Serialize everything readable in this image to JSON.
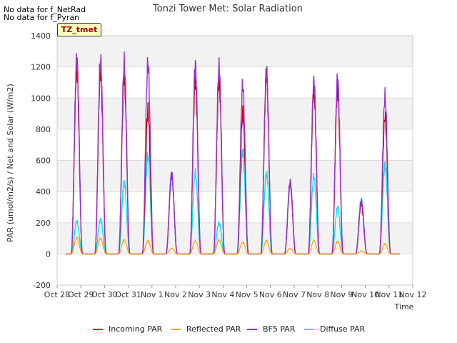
{
  "notes": [
    "No data for f_NetRad",
    "No data for f_Pyran"
  ],
  "badge": "TZ_tmet",
  "chart_data": {
    "type": "line",
    "title": "Tonzi Tower Met: Solar Radiation",
    "xlabel": "Time",
    "ylabel": "PAR (umol/m2/s) / Net and Solar (W/m2)",
    "ylim": [
      -200,
      1400
    ],
    "yticks": [
      -200,
      0,
      200,
      400,
      600,
      800,
      1000,
      1200,
      1400
    ],
    "xlim": [
      0,
      15
    ],
    "xticks": [
      {
        "pos": 0,
        "label": "Oct 28"
      },
      {
        "pos": 1,
        "label": "Oct 29"
      },
      {
        "pos": 2,
        "label": "Oct 30"
      },
      {
        "pos": 3,
        "label": "Oct 31"
      },
      {
        "pos": 4,
        "label": "Nov 1"
      },
      {
        "pos": 5,
        "label": "Nov 2"
      },
      {
        "pos": 6,
        "label": "Nov 3"
      },
      {
        "pos": 7,
        "label": "Nov 4"
      },
      {
        "pos": 8,
        "label": "Nov 5"
      },
      {
        "pos": 9,
        "label": "Nov 6"
      },
      {
        "pos": 10,
        "label": "Nov 7"
      },
      {
        "pos": 11,
        "label": "Nov 8"
      },
      {
        "pos": 12,
        "label": "Nov 9"
      },
      {
        "pos": 13,
        "label": "Nov 10"
      },
      {
        "pos": 14,
        "label": "Nov 11"
      },
      {
        "pos": 15,
        "label": "Nov 12"
      }
    ],
    "grid": true,
    "legend_position": "bottom",
    "series": [
      {
        "name": "Incoming PAR",
        "color": "#cc0000",
        "daily_peaks": [
          1190,
          1170,
          1130,
          920,
          510,
          1120,
          1120,
          900,
          1150,
          450,
          1060,
          1060,
          320,
          880
        ]
      },
      {
        "name": "Reflected PAR",
        "color": "#ffa500",
        "daily_peaks": [
          105,
          100,
          90,
          85,
          35,
          85,
          90,
          75,
          85,
          35,
          85,
          80,
          20,
          65
        ]
      },
      {
        "name": "BF5 PAR",
        "color": "#9b30d0",
        "daily_peaks": [
          1250,
          1245,
          1225,
          1225,
          510,
          1215,
          1200,
          1080,
          1160,
          460,
          1110,
          1120,
          340,
          1010
        ]
      },
      {
        "name": "Diffuse PAR",
        "color": "#00e5ee",
        "daily_peaks": [
          210,
          220,
          460,
          630,
          500,
          520,
          200,
          660,
          520,
          450,
          500,
          300,
          350,
          575
        ]
      }
    ]
  }
}
